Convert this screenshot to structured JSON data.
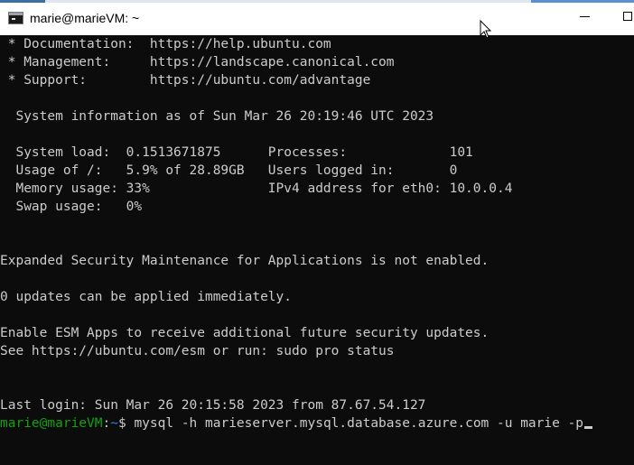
{
  "window": {
    "title": "marie@marieVM: ~"
  },
  "terminal": {
    "lines": [
      " * Documentation:  https://help.ubuntu.com",
      " * Management:     https://landscape.canonical.com",
      " * Support:        https://ubuntu.com/advantage",
      "",
      "  System information as of Sun Mar 26 20:19:46 UTC 2023",
      "",
      "  System load:  0.1513671875      Processes:             101",
      "  Usage of /:   5.9% of 28.89GB   Users logged in:       0",
      "  Memory usage: 33%               IPv4 address for eth0: 10.0.0.4",
      "  Swap usage:   0%",
      "",
      "",
      "Expanded Security Maintenance for Applications is not enabled.",
      "",
      "0 updates can be applied immediately.",
      "",
      "Enable ESM Apps to receive additional future security updates.",
      "See https://ubuntu.com/esm or run: sudo pro status",
      "",
      "",
      "Last login: Sun Mar 26 20:15:58 2023 from 87.67.54.127"
    ],
    "prompt": {
      "user_host": "marie@marieVM",
      "separator": ":",
      "path": "~",
      "symbol": "$ ",
      "command": "mysql -h marieserver.mysql.database.azure.com -u marie -p"
    }
  },
  "colors": {
    "background": "#0c0c0c",
    "foreground": "#cccccc",
    "prompt_user": "#13a10e",
    "prompt_path": "#3b78ff"
  }
}
